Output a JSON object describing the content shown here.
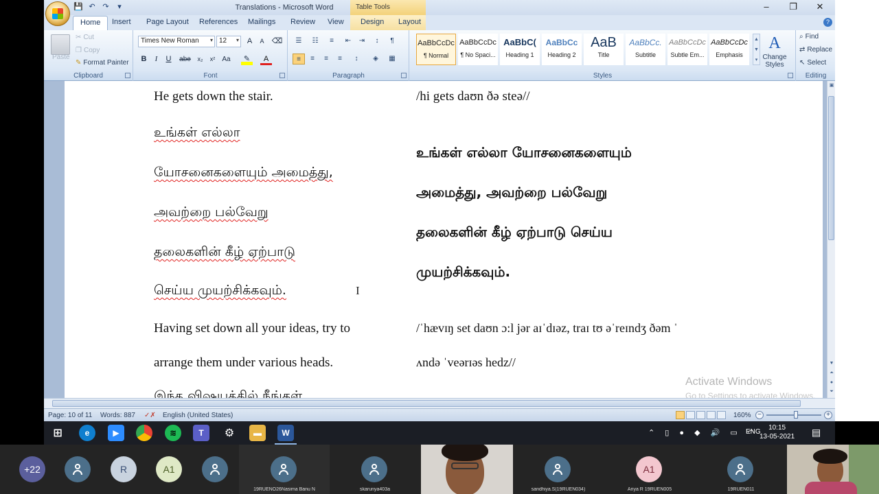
{
  "window": {
    "title": "Translations - Microsoft Word",
    "context_tab_title": "Table Tools",
    "controls": [
      "–",
      "❐",
      "✕"
    ]
  },
  "tabs": [
    "Home",
    "Insert",
    "Page Layout",
    "References",
    "Mailings",
    "Review",
    "View",
    "Design",
    "Layout"
  ],
  "ribbon": {
    "clipboard": {
      "label": "Clipboard",
      "paste": "Paste",
      "cut": "Cut",
      "copy": "Copy",
      "format_painter": "Format Painter"
    },
    "font": {
      "label": "Font",
      "font_name": "Times New Roman",
      "font_size": "12"
    },
    "paragraph": {
      "label": "Paragraph"
    },
    "styles": {
      "label": "Styles",
      "items": [
        {
          "preview": "AaBbCcDc",
          "name": "¶ Normal"
        },
        {
          "preview": "AaBbCcDc",
          "name": "¶ No Spaci..."
        },
        {
          "preview": "AaBbC(",
          "name": "Heading 1"
        },
        {
          "preview": "AaBbCc",
          "name": "Heading 2"
        },
        {
          "preview": "AaB",
          "name": "Title"
        },
        {
          "preview": "AaBbCc.",
          "name": "Subtitle"
        },
        {
          "preview": "AaBbCcDc",
          "name": "Subtle Em..."
        },
        {
          "preview": "AaBbCcDc",
          "name": "Emphasis"
        }
      ],
      "change_styles": "Change Styles"
    },
    "editing": {
      "label": "Editing",
      "find": "Find",
      "replace": "Replace",
      "select": "Select"
    }
  },
  "document": {
    "left_column": {
      "line1": "He gets down the stair.",
      "ta1": "உங்கள் எல்லா",
      "ta2": "யோசனைகளையும் அமைத்து,",
      "ta3": "அவற்றை பல்வேறு",
      "ta4": "தலைகளின் கீழ் ஏற்பாடு",
      "ta5": "செய்ய முயற்சிக்கவும்.",
      "en2": "Having set down all your ideas, try to",
      "en3": "arrange them under various heads.",
      "ta6": "இந்த விஷயத்தில் நீங்கள்"
    },
    "right_column": {
      "ipa1": "/hi gets daʊn ðə steə//",
      "ta1": "உங்கள் எல்லா யோசனைகளையும்",
      "ta2": "அமைத்து, அவற்றை பல்வேறு",
      "ta3": "தலைகளின் கீழ் ஏற்பாடு செய்ய",
      "ta4": "முயற்சிக்கவும்.",
      "ipa2": "/ˈhævɪŋ set daʊn ɔ:l jər aɪˈdɪəz, traɪ tʊ əˈreɪndʒ ðəm ˈ",
      "ipa3": "ʌndə ˈveərɪəs hedz//"
    },
    "watermark": {
      "line1": "Activate Windows",
      "line2": "Go to Settings to activate Windows."
    }
  },
  "statusbar": {
    "page": "Page: 10 of 11",
    "words": "Words: 887",
    "language": "English (United States)",
    "zoom": "160%"
  },
  "taskbar": {
    "time": "10:15",
    "date": "13-05-2021",
    "lang": "ENG"
  },
  "meeting": {
    "more_count": "+22",
    "participants": [
      {
        "initials": "",
        "name": ""
      },
      {
        "initials": "R",
        "name": ""
      },
      {
        "initials": "A1",
        "name": ""
      },
      {
        "initials": "",
        "name": ""
      },
      {
        "initials": "",
        "name": "19RUENO26Nasima Banu N"
      },
      {
        "initials": "",
        "name": "skarunya403a"
      },
      {
        "initials": "",
        "name": "sandhiya.S(19RUEN034)"
      },
      {
        "initials": "A1",
        "name": "Ariya R 19RUEN005"
      },
      {
        "initials": "",
        "name": "19RUEN011"
      }
    ]
  }
}
